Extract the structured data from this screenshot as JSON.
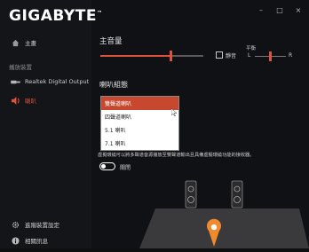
{
  "app": {
    "logo": "GIGABYTE",
    "logo_mark": "™",
    "window_controls": {
      "minimize": "–",
      "maximize": "□",
      "close": "×"
    }
  },
  "sidebar": {
    "home_label": "主畫",
    "section_label": "播放裝置",
    "devices": [
      {
        "label": "Realtek Digital Output",
        "icon": "speaker-plug-icon"
      },
      {
        "label": "喇叭",
        "icon": "speaker-icon",
        "active": true
      }
    ],
    "bottom": [
      {
        "label": "進階裝置設定",
        "icon": "gear-icon"
      },
      {
        "label": "相關訊息",
        "icon": "info-icon"
      }
    ]
  },
  "main": {
    "volume_title": "主音量",
    "volume_level": 0.68,
    "mute_label": "靜音",
    "balance": {
      "title": "平衡",
      "left": "L",
      "right": "R",
      "level": 0.5
    },
    "speaker_config_title": "喇叭組態",
    "speaker_options": [
      "雙聲道喇叭",
      "四聲道喇叭",
      "5.1 喇叭",
      "7.1 喇叭"
    ],
    "selected_option": "雙聲道喇叭",
    "description": "虛擬環繞可以將多聲道音源播放至雙聲道輸出且具備虛擬環繞功能的接收器。",
    "toggle_label": "關閉",
    "toggle_on": false
  },
  "colors": {
    "accent": "#e0523b",
    "selected": "#c7472f",
    "background": "#101114"
  }
}
